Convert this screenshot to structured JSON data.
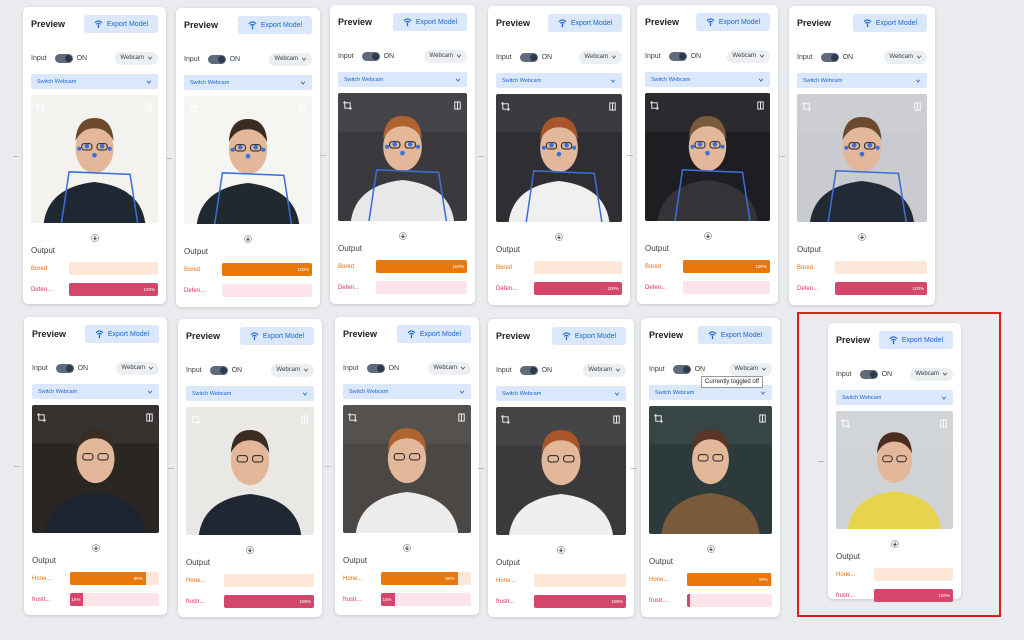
{
  "card_common": {
    "title": "Preview",
    "export_label": "Export Model",
    "input_label": "Input",
    "toggle_state": "ON",
    "source": "Webcam",
    "switch_label": "Switch Webcam",
    "output_title": "Output"
  },
  "tooltip": "Currently toggled off",
  "colors": {
    "accent": "#1a66d2",
    "orange": "#e8770c",
    "pink": "#d4476a",
    "selection": "#e01e1e"
  },
  "icons": [
    "export-icon",
    "chevron-down-icon",
    "crop-icon",
    "flip-icon",
    "download-icon"
  ],
  "cards": [
    {
      "outputs": [
        {
          "label": "Bored",
          "value": 0
        },
        {
          "label": "Defen...",
          "value": 100
        }
      ]
    },
    {
      "outputs": [
        {
          "label": "Bored",
          "value": 100
        },
        {
          "label": "Defen...",
          "value": 0
        }
      ]
    },
    {
      "outputs": [
        {
          "label": "Bored",
          "value": 100
        },
        {
          "label": "Defen...",
          "value": 0
        }
      ]
    },
    {
      "outputs": [
        {
          "label": "Bored",
          "value": 0
        },
        {
          "label": "Defen...",
          "value": 100
        }
      ]
    },
    {
      "outputs": [
        {
          "label": "Bored",
          "value": 100
        },
        {
          "label": "Defen...",
          "value": 0
        }
      ]
    },
    {
      "outputs": [
        {
          "label": "Bored",
          "value": 0
        },
        {
          "label": "Defen...",
          "value": 100
        }
      ]
    },
    {
      "outputs": [
        {
          "label": "Hone...",
          "value": 85
        },
        {
          "label": "frustr...",
          "value": 15
        }
      ]
    },
    {
      "outputs": [
        {
          "label": "Hone...",
          "value": 0
        },
        {
          "label": "frustr...",
          "value": 100
        }
      ]
    },
    {
      "outputs": [
        {
          "label": "Hone...",
          "value": 85
        },
        {
          "label": "frustr...",
          "value": 15
        }
      ]
    },
    {
      "outputs": [
        {
          "label": "Hone...",
          "value": 0
        },
        {
          "label": "frustr...",
          "value": 100
        }
      ]
    },
    {
      "outputs": [
        {
          "label": "Hone...",
          "value": 99
        },
        {
          "label": "frustr...",
          "value": 1
        }
      ]
    },
    {
      "outputs": [
        {
          "label": "Hone...",
          "value": 0
        },
        {
          "label": "frustr...",
          "value": 100
        }
      ]
    }
  ]
}
